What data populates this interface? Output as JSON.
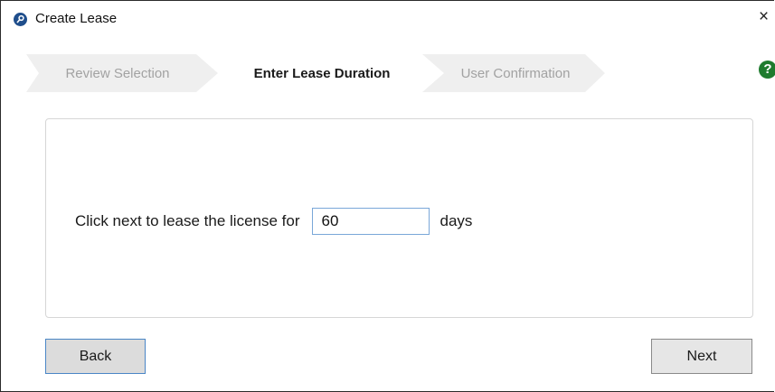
{
  "window": {
    "title": "Create Lease",
    "app_icon": "key-circle-icon",
    "close_label": "×",
    "help_label": "?"
  },
  "wizard": {
    "steps": [
      {
        "label": "Review Selection",
        "state": "done"
      },
      {
        "label": "Enter Lease Duration",
        "state": "active"
      },
      {
        "label": "User Confirmation",
        "state": "pending"
      }
    ]
  },
  "form": {
    "prompt": "Click next to lease the license for",
    "days_value": "60",
    "unit": "days"
  },
  "buttons": {
    "back": "Back",
    "next": "Next"
  },
  "colors": {
    "accent": "#1f4e8c",
    "help": "#1e7b2e",
    "focus_border": "#4a86c6"
  }
}
